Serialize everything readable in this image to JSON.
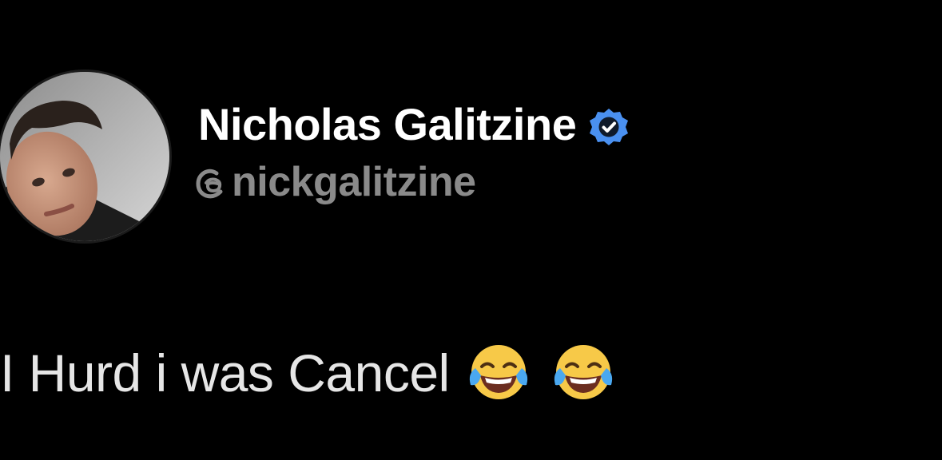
{
  "profile": {
    "display_name": "Nicholas Galitzine",
    "verified_icon": "verified-badge-icon",
    "handle_icon": "threads-logo-icon",
    "handle": "nickgalitzine",
    "verified_color": "#4a90f0"
  },
  "post": {
    "text": "I Hurd i was Cancel",
    "emojis": [
      "face-with-tears-of-joy",
      "face-with-tears-of-joy"
    ]
  }
}
